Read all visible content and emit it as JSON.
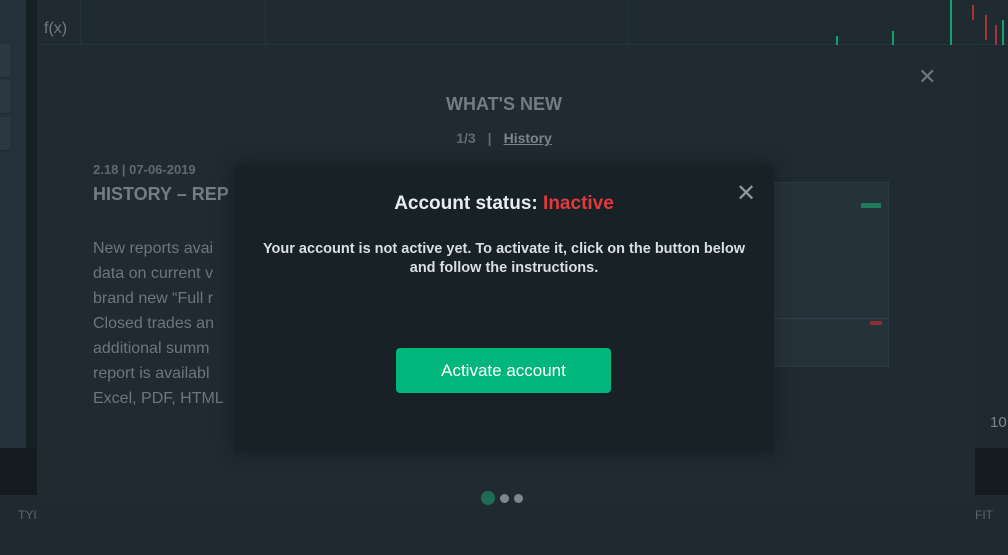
{
  "background": {
    "function_label": "f(x)",
    "axis_value": "10",
    "table_col_left": "TYI",
    "table_col_right": "FIT"
  },
  "whats_new": {
    "title": "WHAT'S NEW",
    "page": "1/3",
    "separator": "|",
    "history_link": "History",
    "version_date": "2.18 | 07-06-2019",
    "heading": "HISTORY – REP",
    "body_lines": [
      "New reports avai",
      "data on current v",
      "brand new “Full r",
      "Closed trades an",
      "additional summ",
      "report is availabl",
      "Excel, PDF, HTML"
    ],
    "close_icon": "close-icon",
    "current_slide": 1,
    "total_slides": 3
  },
  "dialog": {
    "title_prefix": "Account status:",
    "status": "Inactive",
    "status_color": "#e0393e",
    "message": "Your account is not active yet. To activate it, click on the button below and follow the instructions.",
    "button_label": "Activate account",
    "button_color": "#00b67a",
    "close_icon": "close-icon"
  }
}
